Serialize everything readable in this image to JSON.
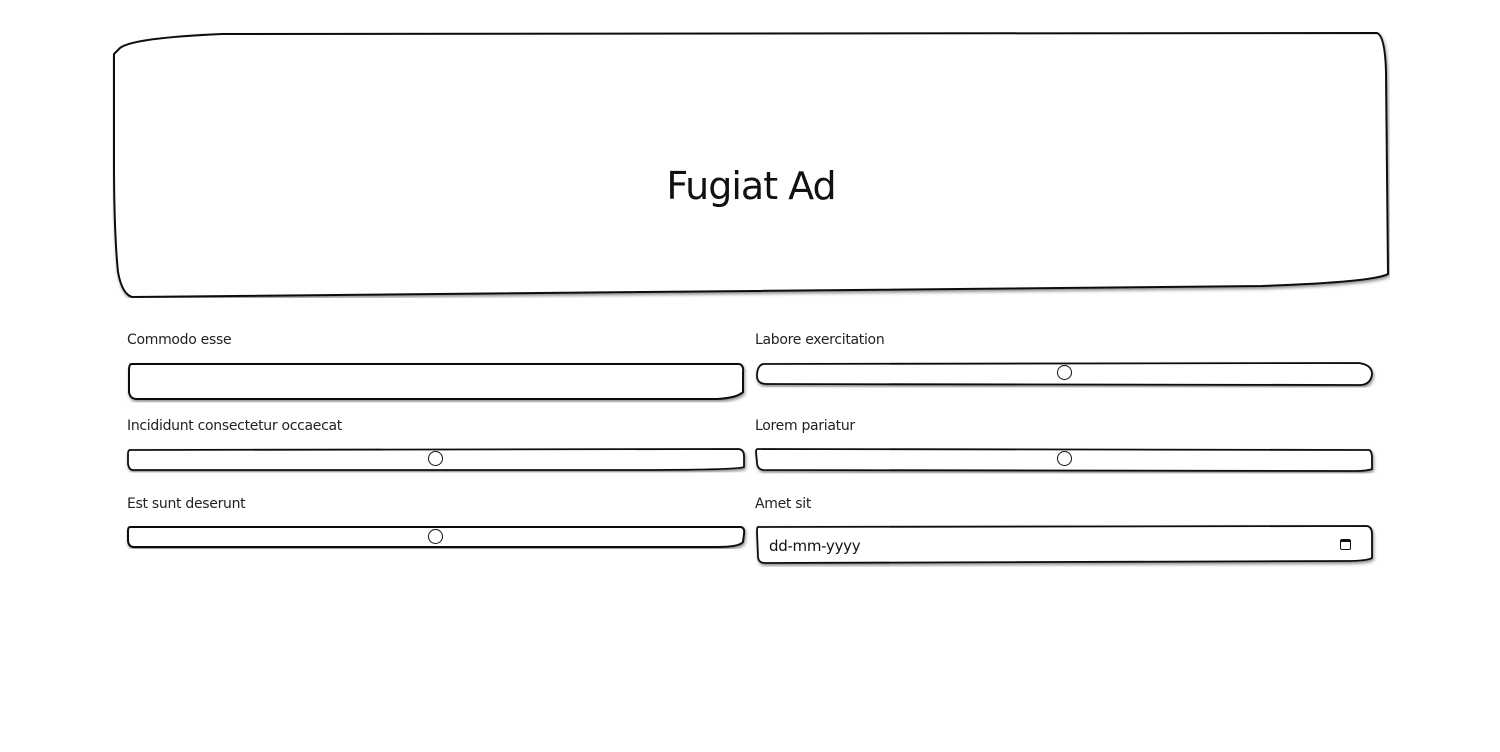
{
  "hero": {
    "title": "Fugiat Ad"
  },
  "fields": {
    "commodo_esse": {
      "label": "Commodo esse",
      "value": ""
    },
    "labore_exercitation": {
      "label": "Labore exercitation",
      "value_percent": 50
    },
    "incididunt": {
      "label": "Incididunt consectetur occaecat",
      "value_percent": 50
    },
    "lorem_pariatur": {
      "label": "Lorem pariatur",
      "value_percent": 50
    },
    "est_sunt": {
      "label": "Est sunt deserunt",
      "value_percent": 50
    },
    "amet_sit": {
      "label": "Amet sit",
      "placeholder": "dd-mm-yyyy"
    }
  },
  "icons": {
    "calendar": "calendar-icon"
  }
}
